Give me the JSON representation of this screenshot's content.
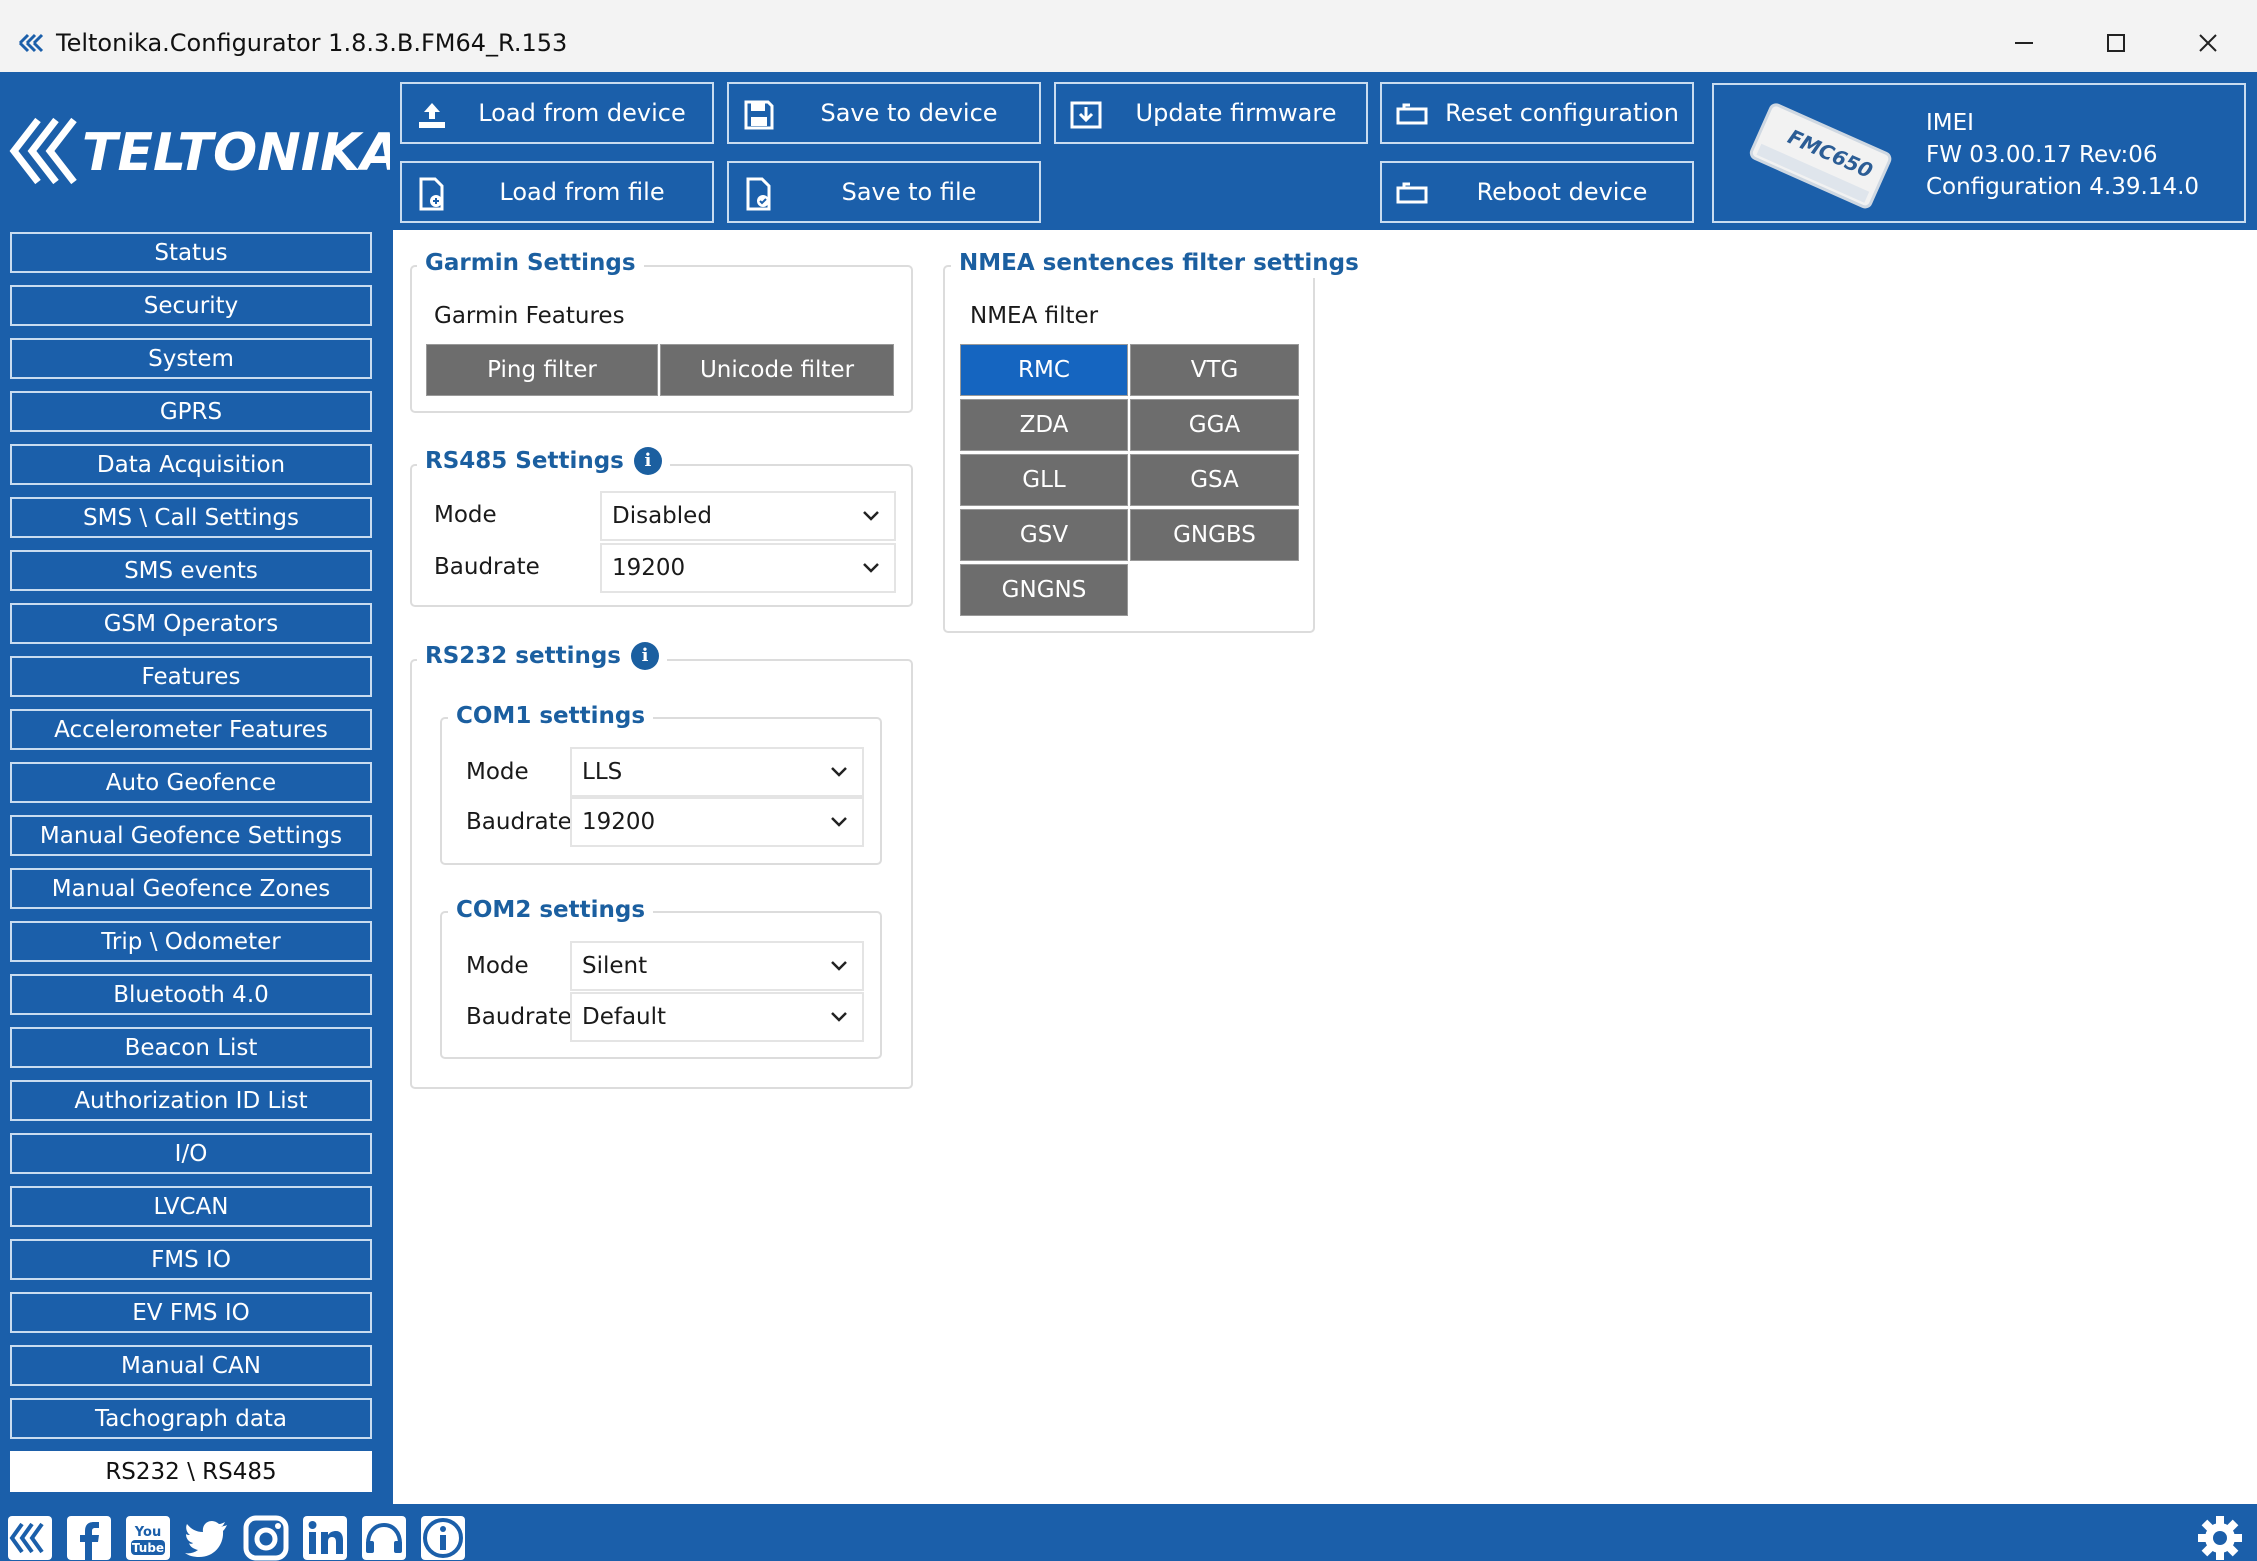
{
  "window": {
    "title": "Teltonika.Configurator 1.8.3.B.FM64_R.153",
    "controls": [
      "minimize-icon",
      "maximize-icon",
      "close-icon"
    ]
  },
  "brand": {
    "logo_text": "TELTONIKA",
    "accent_color": "#1b5faa",
    "selected_color": "#1565c0",
    "button_gray": "#6d6d6d"
  },
  "toolbar": {
    "load_from_device": "Load from device",
    "save_to_device": "Save to device",
    "update_firmware": "Update firmware",
    "reset_configuration": "Reset configuration",
    "load_from_file": "Load from file",
    "save_to_file": "Save to file",
    "reboot_device": "Reboot device"
  },
  "device": {
    "model": "FMC650",
    "imei_label": "IMEI",
    "fw": "FW  03.00.17 Rev:06",
    "configuration": "Configuration  4.39.14.0"
  },
  "sidebar": {
    "items": [
      {
        "label": "Status"
      },
      {
        "label": "Security"
      },
      {
        "label": "System"
      },
      {
        "label": "GPRS"
      },
      {
        "label": "Data Acquisition"
      },
      {
        "label": "SMS \\ Call Settings"
      },
      {
        "label": "SMS events"
      },
      {
        "label": "GSM Operators"
      },
      {
        "label": "Features"
      },
      {
        "label": "Accelerometer Features"
      },
      {
        "label": "Auto Geofence"
      },
      {
        "label": "Manual Geofence Settings"
      },
      {
        "label": "Manual Geofence Zones"
      },
      {
        "label": "Trip \\ Odometer"
      },
      {
        "label": "Bluetooth 4.0"
      },
      {
        "label": "Beacon List"
      },
      {
        "label": "Authorization ID List"
      },
      {
        "label": "I/O"
      },
      {
        "label": "LVCAN"
      },
      {
        "label": "FMS IO"
      },
      {
        "label": "EV FMS IO"
      },
      {
        "label": "Manual CAN"
      },
      {
        "label": "Tachograph data"
      },
      {
        "label": "RS232 \\ RS485"
      }
    ],
    "active_index": 23
  },
  "garmin": {
    "title": "Garmin Settings",
    "features_label": "Garmin Features",
    "ping_filter": "Ping filter",
    "unicode_filter": "Unicode filter"
  },
  "rs485": {
    "title": "RS485 Settings",
    "mode_label": "Mode",
    "mode_value": "Disabled",
    "baudrate_label": "Baudrate",
    "baudrate_value": "19200"
  },
  "rs232": {
    "title": "RS232 settings",
    "com1": {
      "title": "COM1 settings",
      "mode_label": "Mode",
      "mode_value": "LLS",
      "baudrate_label": "Baudrate",
      "baudrate_value": "19200"
    },
    "com2": {
      "title": "COM2 settings",
      "mode_label": "Mode",
      "mode_value": "Silent",
      "baudrate_label": "Baudrate",
      "baudrate_value": "Default"
    }
  },
  "nmea": {
    "title": "NMEA sentences filter settings",
    "filter_label": "NMEA filter",
    "sentences": [
      {
        "label": "RMC",
        "selected": true
      },
      {
        "label": "VTG",
        "selected": false
      },
      {
        "label": "ZDA",
        "selected": false
      },
      {
        "label": "GGA",
        "selected": false
      },
      {
        "label": "GLL",
        "selected": false
      },
      {
        "label": "GSA",
        "selected": false
      },
      {
        "label": "GSV",
        "selected": false
      },
      {
        "label": "GNGBS",
        "selected": false
      },
      {
        "label": "GNGNS",
        "selected": false
      }
    ]
  },
  "footer": {
    "icons": [
      "teltonika-icon",
      "facebook-icon",
      "youtube-icon",
      "twitter-icon",
      "instagram-icon",
      "linkedin-icon",
      "support-icon",
      "info-icon",
      "settings-gear-icon"
    ]
  }
}
